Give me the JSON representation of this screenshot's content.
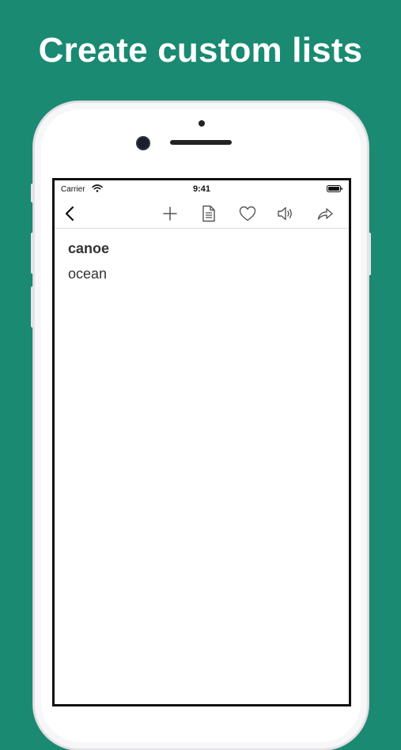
{
  "headline": "Create custom lists",
  "status_bar": {
    "carrier": "Carrier",
    "time": "9:41"
  },
  "toolbar": {
    "buttons": [
      {
        "name": "back",
        "icon": "chevron-left-icon"
      },
      {
        "name": "add",
        "icon": "plus-icon"
      },
      {
        "name": "document",
        "icon": "document-icon"
      },
      {
        "name": "favorite",
        "icon": "heart-icon"
      },
      {
        "name": "speak",
        "icon": "speaker-icon"
      },
      {
        "name": "share",
        "icon": "share-arrow-icon"
      }
    ]
  },
  "entry": {
    "word": "canoe",
    "translation": "ocean"
  },
  "colors": {
    "background": "#1a8a72",
    "headline": "#ffffff",
    "icon": "#555555"
  }
}
